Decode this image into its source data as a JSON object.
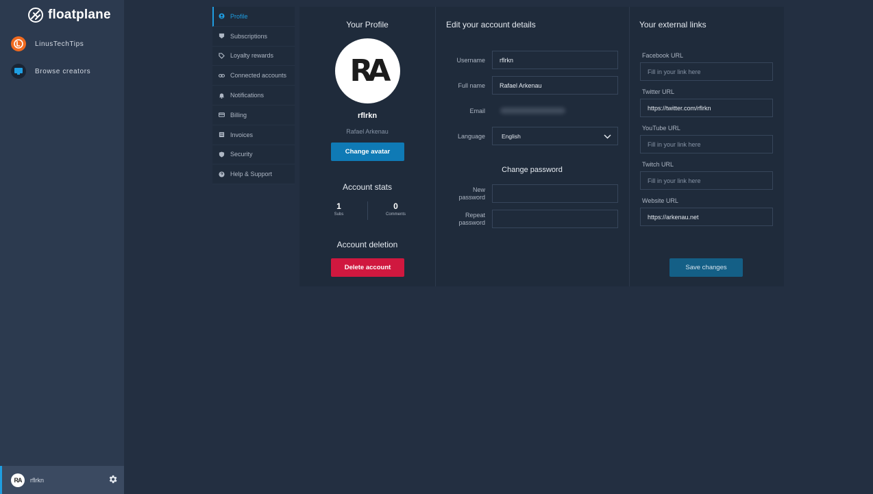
{
  "app": {
    "brand": "floatplane",
    "accent": "#1f9ee2"
  },
  "sidebar": {
    "items": [
      {
        "label": "LinusTechTips",
        "icon": "ltt-logo-icon"
      },
      {
        "label": "Browse creators",
        "icon": "browse-icon"
      }
    ],
    "user": {
      "name": "rflrkn",
      "avatar_initials": "RA"
    }
  },
  "settings_nav": {
    "active": "Profile",
    "items": [
      {
        "label": "Profile",
        "icon": "user-icon"
      },
      {
        "label": "Subscriptions",
        "icon": "badge-icon"
      },
      {
        "label": "Loyalty rewards",
        "icon": "tag-icon"
      },
      {
        "label": "Connected accounts",
        "icon": "link-icon"
      },
      {
        "label": "Notifications",
        "icon": "bell-icon"
      },
      {
        "label": "Billing",
        "icon": "card-icon"
      },
      {
        "label": "Invoices",
        "icon": "invoice-icon"
      },
      {
        "label": "Security",
        "icon": "shield-icon"
      },
      {
        "label": "Help & Support",
        "icon": "help-icon"
      }
    ]
  },
  "profile": {
    "title": "Your Profile",
    "avatar_initials": "RA",
    "username": "rflrkn",
    "full_name": "Rafael Arkenau",
    "change_avatar": "Change avatar",
    "stats_title": "Account stats",
    "stats": [
      {
        "value": "1",
        "label": "Subs"
      },
      {
        "value": "0",
        "label": "Comments"
      }
    ],
    "deletion_title": "Account deletion",
    "delete_button": "Delete account"
  },
  "account": {
    "title": "Edit your account details",
    "username_label": "Username",
    "username_value": "rflrkn",
    "fullname_label": "Full name",
    "fullname_value": "Rafael Arkenau",
    "email_label": "Email",
    "language_label": "Language",
    "language_value": "English",
    "password_title": "Change password",
    "new_password_label_1": "New",
    "new_password_label_2": "password",
    "repeat_password_label_1": "Repeat",
    "repeat_password_label_2": "password"
  },
  "external": {
    "title": "Your external links",
    "fields": [
      {
        "label": "Facebook URL",
        "value": "",
        "placeholder": "Fill in your link here"
      },
      {
        "label": "Twitter URL",
        "value": "https://twitter.com/rflrkn",
        "placeholder": "Fill in your link here"
      },
      {
        "label": "YouTube URL",
        "value": "",
        "placeholder": "Fill in your link here"
      },
      {
        "label": "Twitch URL",
        "value": "",
        "placeholder": "Fill in your link here"
      },
      {
        "label": "Website URL",
        "value": "https://arkenau.net",
        "placeholder": "Fill in your link here"
      }
    ],
    "save_button": "Save changes"
  }
}
